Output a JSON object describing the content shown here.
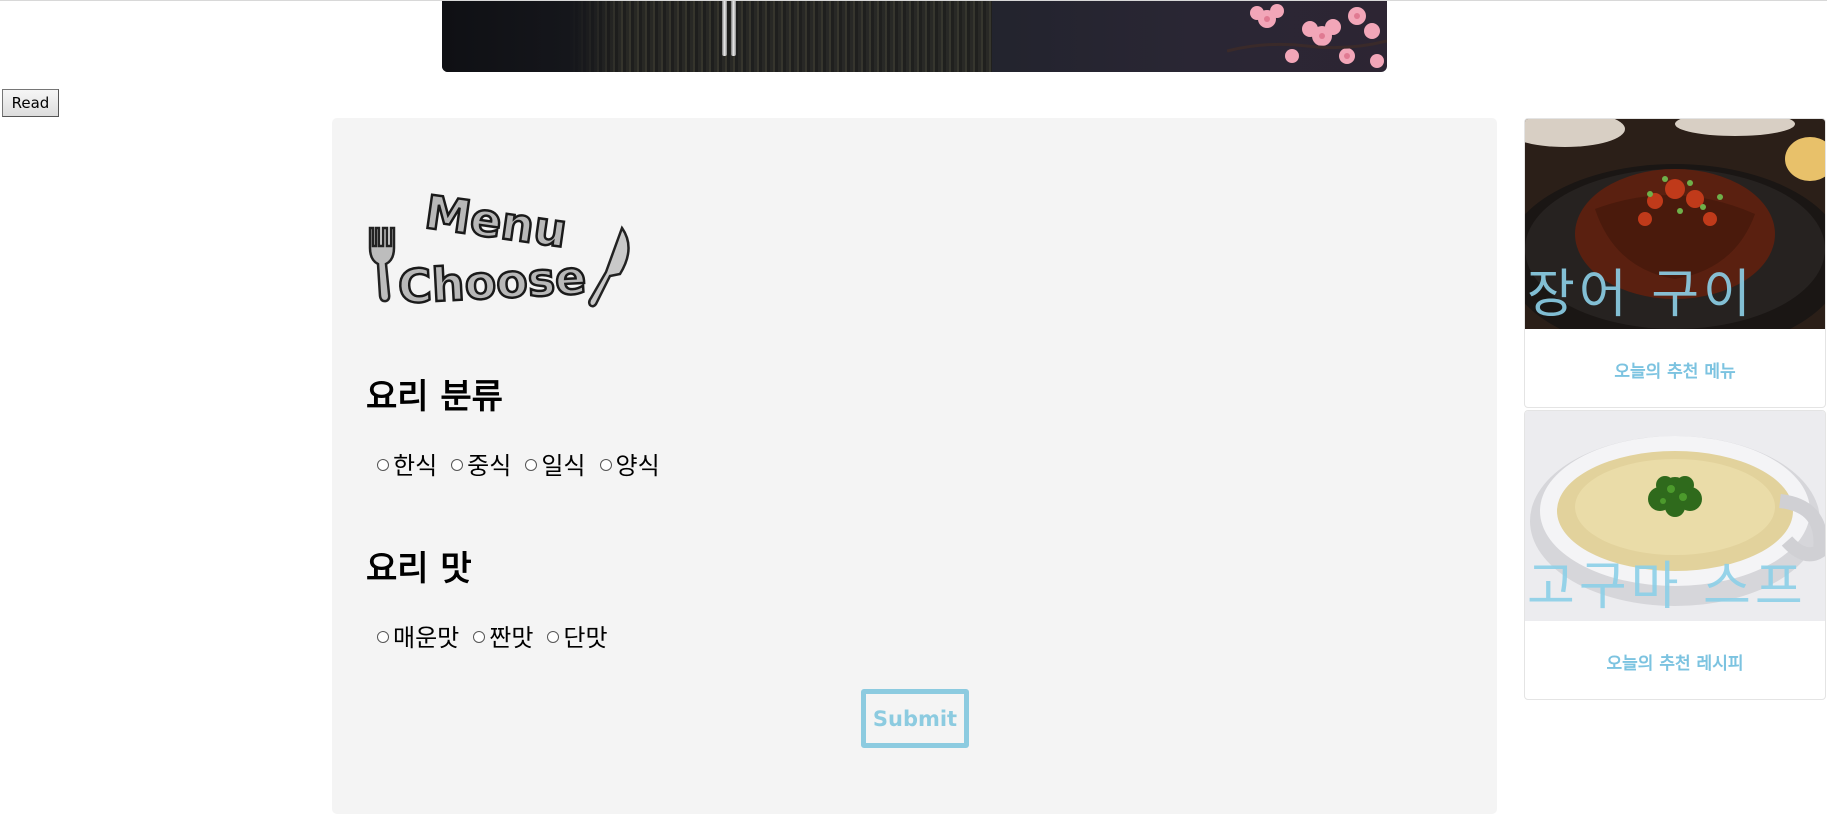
{
  "read_button": {
    "label": "Read"
  },
  "banner": {
    "alt": "banner image"
  },
  "logo": {
    "line1": "Menu",
    "line2": "Choose"
  },
  "sections": [
    {
      "title": "요리 분류",
      "options": [
        "한식",
        "중식",
        "일식",
        "양식"
      ]
    },
    {
      "title": "요리 맛",
      "options": [
        "매운맛",
        "짠맛",
        "단맛"
      ]
    }
  ],
  "submit": {
    "label": "Submit"
  },
  "cards": [
    {
      "image_text": "장어 구이",
      "caption": "오늘의 추천 메뉴"
    },
    {
      "image_text": "고구마 스프",
      "caption": "오늘의 추천 레시피"
    }
  ],
  "colors": {
    "panel_bg": "#f4f4f4",
    "accent": "#8ccbe0",
    "caption": "#7cc3e0"
  }
}
